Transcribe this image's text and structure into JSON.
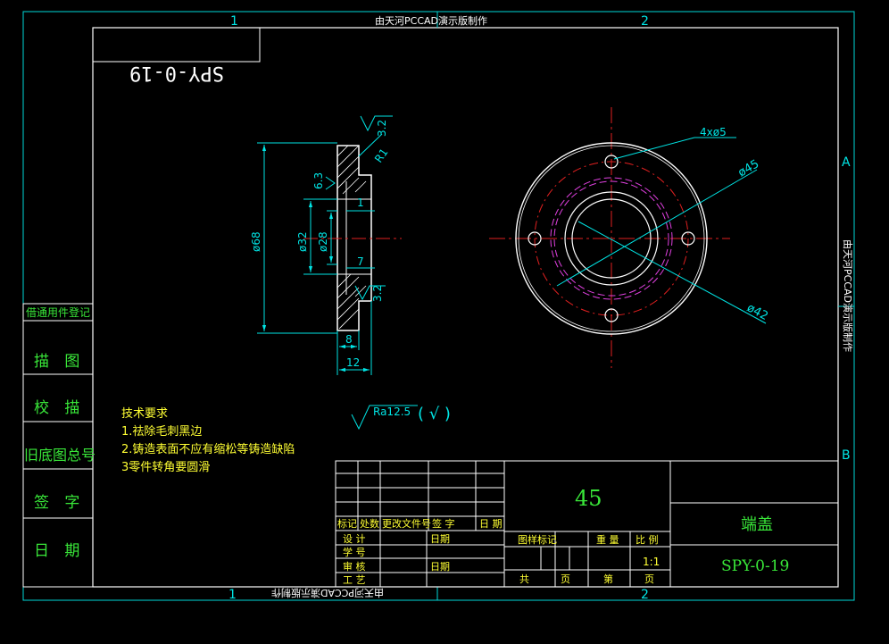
{
  "sheet": {
    "grid_top": [
      "1",
      "2"
    ],
    "grid_bottom": [
      "1",
      "2"
    ],
    "grid_right": [
      "A",
      "B"
    ],
    "watermark": "由天河PCCAD演示版制作"
  },
  "mirrored_code": "SPY-0-19",
  "left_stamp": {
    "header": "借通用件登记",
    "rows": [
      "描 图",
      "校 描",
      "旧底图总号",
      "签 字",
      "日 期"
    ]
  },
  "side_view_dims": {
    "roughness_top": "3.2",
    "radius": "R1",
    "d68": "ø68",
    "d32": "ø32",
    "d28": "ø28",
    "roughness_left": "6.3",
    "dim_1": "1",
    "dim_7": "7",
    "roughness_bottom": "3.2",
    "dim_8": "8",
    "dim_12": "12"
  },
  "front_view_dims": {
    "holes": "4xø5",
    "pcd": "ø45",
    "bore": "ø42"
  },
  "roughness_note": {
    "value": "Ra12.5",
    "suffix": "( √ )"
  },
  "technical_requirements": {
    "title": "技术要求",
    "items": [
      "1.祛除毛刺黑边",
      "2.铸造表面不应有缩松等铸造缺陷",
      "3零件转角要圆滑"
    ]
  },
  "title_block": {
    "material": "45",
    "part_name": "端盖",
    "drawing_no": "SPY-0-19",
    "rev_headers": [
      "标记",
      "处数",
      "更改文件号",
      "签 字",
      "日 期"
    ],
    "design": "设 计",
    "date_1": "日期",
    "standard": "学 号",
    "review": "审 核",
    "date_2": "日期",
    "process": "工 艺",
    "stage_mark": "图样标记",
    "weight": "重 量",
    "scale": "比 例",
    "scale_value": "1:1",
    "total": "共",
    "sheet_unit_1": "页",
    "sheet_no": "第",
    "sheet_unit_2": "页"
  }
}
